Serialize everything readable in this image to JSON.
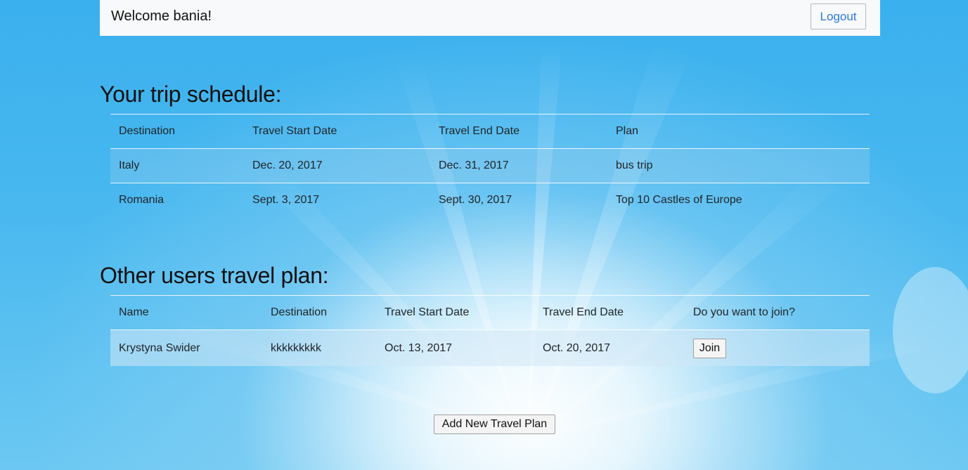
{
  "header": {
    "welcome": "Welcome bania!",
    "logout_label": "Logout"
  },
  "trip_schedule": {
    "title": "Your trip schedule:",
    "columns": [
      "Destination",
      "Travel Start Date",
      "Travel End Date",
      "Plan"
    ],
    "rows": [
      {
        "destination": "Italy",
        "start": "Dec. 20, 2017",
        "end": "Dec. 31, 2017",
        "plan": "bus trip"
      },
      {
        "destination": "Romania",
        "start": "Sept. 3, 2017",
        "end": "Sept. 30, 2017",
        "plan": "Top 10 Castles of Europe"
      }
    ]
  },
  "other_plans": {
    "title": "Other users travel plan:",
    "columns": [
      "Name",
      "Destination",
      "Travel Start Date",
      "Travel End Date",
      "Do you want to join?"
    ],
    "rows": [
      {
        "name": "Krystyna Swider",
        "destination": "kkkkkkkkk",
        "start": "Oct. 13, 2017",
        "end": "Oct. 20, 2017",
        "action_label": "Join"
      }
    ]
  },
  "add_plan_label": "Add New Travel Plan",
  "colors": {
    "sky": "#3ab0ee",
    "navbar_bg": "#f8f9fa",
    "link_blue": "#2a7ae2"
  }
}
